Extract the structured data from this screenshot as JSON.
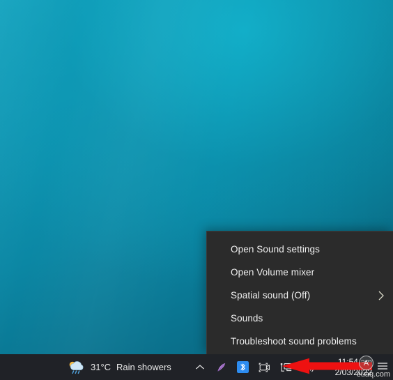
{
  "desktop": {
    "wallpaper_color_top": "#14a8c4",
    "wallpaper_color_bottom": "#0a5f79"
  },
  "context_menu": {
    "name": "sound-tray-context-menu",
    "background_color": "#2b2b2b",
    "items": [
      {
        "label": "Open Sound settings",
        "has_submenu": false
      },
      {
        "label": "Open Volume mixer",
        "has_submenu": false
      },
      {
        "label": "Spatial sound (Off)",
        "has_submenu": true
      },
      {
        "label": "Sounds",
        "has_submenu": false
      },
      {
        "label": "Troubleshoot sound problems",
        "has_submenu": false
      }
    ]
  },
  "taskbar": {
    "background_color": "#202227",
    "weather": {
      "icon": "sun-behind-rain-cloud-icon",
      "temperature": "31°C",
      "condition": "Rain showers"
    },
    "tray_icons": [
      {
        "name": "show-hidden-icons-chevron-icon",
        "glyph": "chevron-up"
      },
      {
        "name": "pen-feather-icon",
        "glyph": "feather",
        "color": "#b27fd6"
      },
      {
        "name": "bluetooth-icon",
        "glyph": "bluetooth",
        "color": "#2d8cf0"
      },
      {
        "name": "camera-icon",
        "glyph": "camera"
      },
      {
        "name": "network-display-icon",
        "glyph": "monitor"
      },
      {
        "name": "volume-speaker-icon",
        "glyph": "speaker"
      }
    ],
    "clock": {
      "time": "11:54 am",
      "date": "2/03/2022"
    },
    "notification_icon": "notifications-icon"
  },
  "annotation": {
    "arrow": {
      "name": "red-pointer-arrow",
      "color": "#ee1111",
      "direction": "left"
    }
  },
  "watermark": {
    "badge": "A",
    "text": "euaq.com"
  }
}
